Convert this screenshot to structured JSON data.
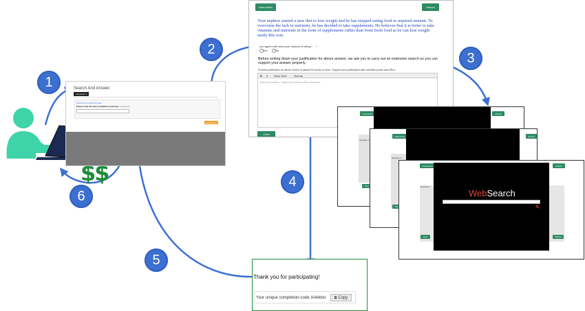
{
  "badges": [
    "1",
    "2",
    "3",
    "4",
    "5",
    "6"
  ],
  "search_answer": {
    "title": "Search And Answer",
    "tab": "Instruction 1",
    "link": "Click here to begin the task",
    "prompt": "Please enter the task completion code here",
    "hint": "(required)",
    "submit": "Get Started"
  },
  "task_page": {
    "instructions_btn": "Instructions",
    "search_btn": "Search",
    "story": "Your nephew started a new diet to lose weight and he has stopped eating food in required amount. To overcome the lack in nutrients, be has decided to take supplements. He believes that it is better to take vitamins and nutrients in the form of supplements rather than from fresh food as be can lose weight easily this way.",
    "question": "you agree with what your nephew is doing?",
    "required_mark": "*",
    "yes": "Yes",
    "no": "No",
    "before_writing": "Before writing down your justification for above answer, we ask you to carry out an extensive search so you can support your answer properly.",
    "provide": "Provide justification for above choice in atleast 50 words or more. Support your justification with scientific proofs and URLs.",
    "toolbar": {
      "bold": "B",
      "italic": "Z",
      "font": "Sans Serif",
      "size": "Normal"
    },
    "editor_placeholder": "Enter your reasons. Support your reasons where necessary.",
    "clear_btn": "Clear"
  },
  "stacked": {
    "instructions": "Instructions",
    "search": "Search",
    "question": "Question 1",
    "next": "Next",
    "submit": "Submit"
  },
  "websearch": {
    "logo_web": "Web",
    "logo_search": "Search"
  },
  "thanks": {
    "message": "Thank you for participating!",
    "code_label": "Your unique completion-code:",
    "code": "lA4eblsr",
    "copy": "Copy"
  },
  "money": "$$",
  "colors": {
    "arrow": "#3c6fd0",
    "person": "#3ed3a8",
    "money": "#1e8c3a",
    "task_green": "#2f8a62",
    "websearch_red": "#e0473a"
  }
}
